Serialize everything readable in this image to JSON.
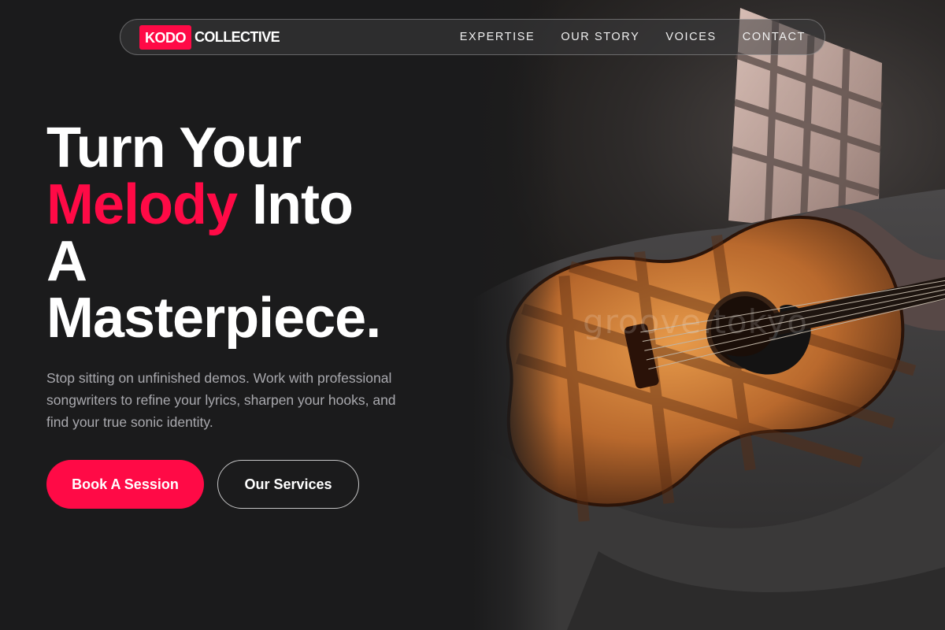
{
  "brand": {
    "badge": "KODO",
    "name": "COLLECTIVE",
    "accent_color": "#ff0a46"
  },
  "nav": {
    "items": [
      {
        "label": "EXPERTISE"
      },
      {
        "label": "OUR STORY"
      },
      {
        "label": "VOICES"
      },
      {
        "label": "CONTACT"
      }
    ]
  },
  "hero": {
    "headline": {
      "line1": "Turn Your",
      "accent": "Melody",
      "line2_rest": " Into",
      "line3": "A",
      "line4": "Masterpiece."
    },
    "subtitle": "Stop sitting on unfinished demos. Work with professional songwriters to refine your lyrics, sharpen your hooks, and find your true sonic identity.",
    "primary_cta": "Book A Session",
    "secondary_cta": "Our Services"
  },
  "photo": {
    "subject": "acoustic-guitar-on-blanket",
    "watermark": "groove.tokyo"
  }
}
